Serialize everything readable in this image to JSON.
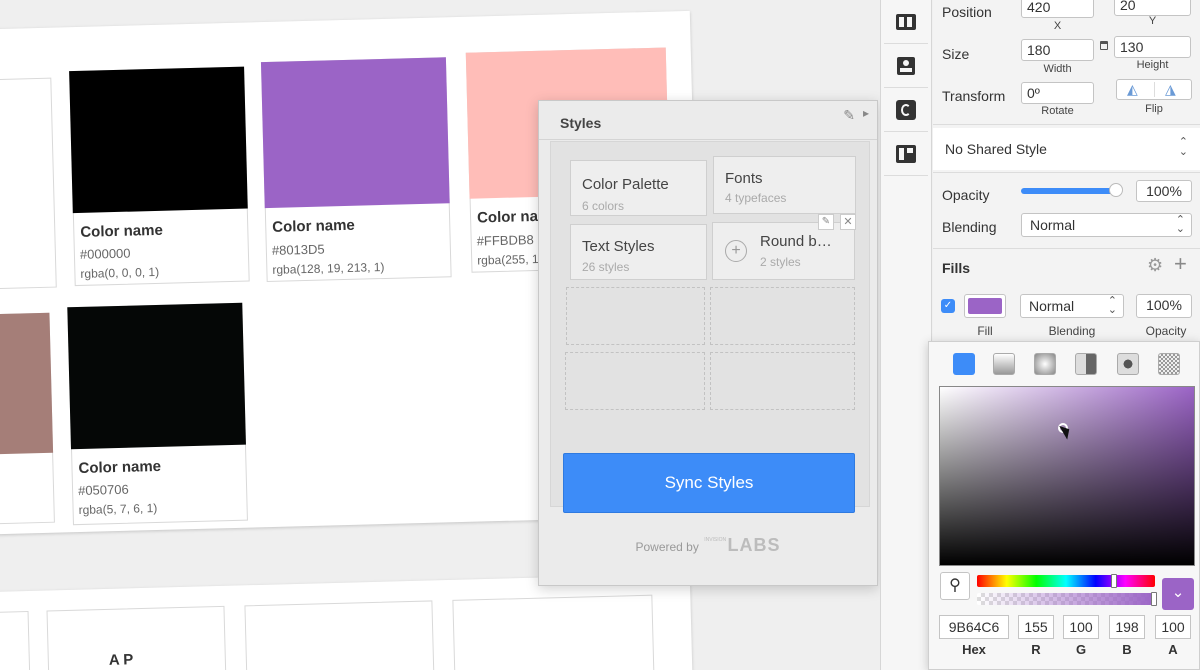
{
  "canvas": {
    "cards": [
      {
        "name": "Color name",
        "hex": "#000000",
        "rgba": "rgba(0, 0, 0, 1)",
        "color": "#000000"
      },
      {
        "name": "Color name",
        "hex": "#8013D5",
        "rgba": "rgba(128, 19, 213, 1)",
        "color": "#9b64c6"
      },
      {
        "name": "Color nar",
        "hex": "#FFBDB8",
        "rgba": "rgba(255, 1",
        "color": "#ffbdb8"
      },
      {
        "name": "Color name",
        "hex": "#050706",
        "rgba": "rgba(5, 7, 6, 1)",
        "color": "#050706"
      }
    ],
    "partial_swatch_color": "#a57e78",
    "bottom_text": "A P"
  },
  "styles_panel": {
    "title": "Styles",
    "tiles": [
      {
        "title": "Color Palette",
        "subtitle": "6 colors"
      },
      {
        "title": "Fonts",
        "subtitle": "4 typefaces"
      },
      {
        "title": "Text Styles",
        "subtitle": "26 styles"
      },
      {
        "title": "Round b…",
        "subtitle": "2 styles"
      }
    ],
    "sync_label": "Sync Styles",
    "powered_by": "Powered by",
    "brand_small": "INVISION",
    "brand": "LABS",
    "accent": "#3d8cf8"
  },
  "inspector": {
    "position_label": "Position",
    "x_value": "420",
    "x_label": "X",
    "y_value": "20",
    "y_label": "Y",
    "size_label": "Size",
    "width_value": "180",
    "width_label": "Width",
    "height_value": "130",
    "height_label": "Height",
    "transform_label": "Transform",
    "rotate_value": "0º",
    "rotate_label": "Rotate",
    "flip_label": "Flip",
    "shared_style": "No Shared Style",
    "opacity_label": "Opacity",
    "opacity_value": "100%",
    "blending_label": "Blending",
    "blending_value": "Normal",
    "fills_label": "Fills",
    "fill_blend_value": "Normal",
    "fill_opacity_value": "100%",
    "fill_label": "Fill",
    "fill_blending_label": "Blending",
    "fill_opacity_label": "Opacity",
    "fill_color": "#9b64c6"
  },
  "picker": {
    "hex_value": "9B64C6",
    "hex_label": "Hex",
    "r_value": "155",
    "r_label": "R",
    "g_value": "100",
    "g_label": "G",
    "b_value": "198",
    "b_label": "B",
    "a_value": "100",
    "a_label": "A",
    "hue_position": 0.77
  }
}
